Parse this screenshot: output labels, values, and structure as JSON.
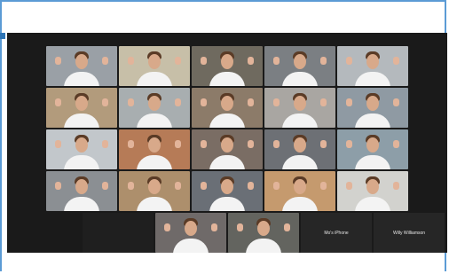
{
  "window": {
    "top_left_text": "",
    "top_right_text": "",
    "view_label": ""
  },
  "participants": [
    {
      "type": "video",
      "bg": "#9aa0a6"
    },
    {
      "type": "video",
      "bg": "#c7bfa8"
    },
    {
      "type": "video",
      "bg": "#6f6a5f"
    },
    {
      "type": "video",
      "bg": "#7b7f83"
    },
    {
      "type": "video",
      "bg": "#b4b9bd"
    },
    {
      "type": "video",
      "bg": "#b29b7c"
    },
    {
      "type": "video",
      "bg": "#a8aeb0"
    },
    {
      "type": "video",
      "bg": "#8c7b69"
    },
    {
      "type": "video",
      "bg": "#a9a6a2"
    },
    {
      "type": "video",
      "bg": "#8f9aa3"
    },
    {
      "type": "video",
      "bg": "#c2c7cb"
    },
    {
      "type": "video",
      "bg": "#b67b57"
    },
    {
      "type": "video",
      "bg": "#7a6d64"
    },
    {
      "type": "video",
      "bg": "#6d7075"
    },
    {
      "type": "video",
      "bg": "#8d9ea8"
    },
    {
      "type": "video",
      "bg": "#8b8f93"
    },
    {
      "type": "video",
      "bg": "#ad8f6c"
    },
    {
      "type": "video",
      "bg": "#6a6f76"
    },
    {
      "type": "video",
      "bg": "#c59a6e"
    },
    {
      "type": "video",
      "bg": "#d2d2ce"
    },
    {
      "type": "blank"
    },
    {
      "type": "video",
      "bg": "#6f6a69"
    },
    {
      "type": "video",
      "bg": "#63645f"
    },
    {
      "type": "name",
      "name": "Mo's iPhone"
    },
    {
      "type": "name",
      "name": "Willy Williamson"
    }
  ]
}
